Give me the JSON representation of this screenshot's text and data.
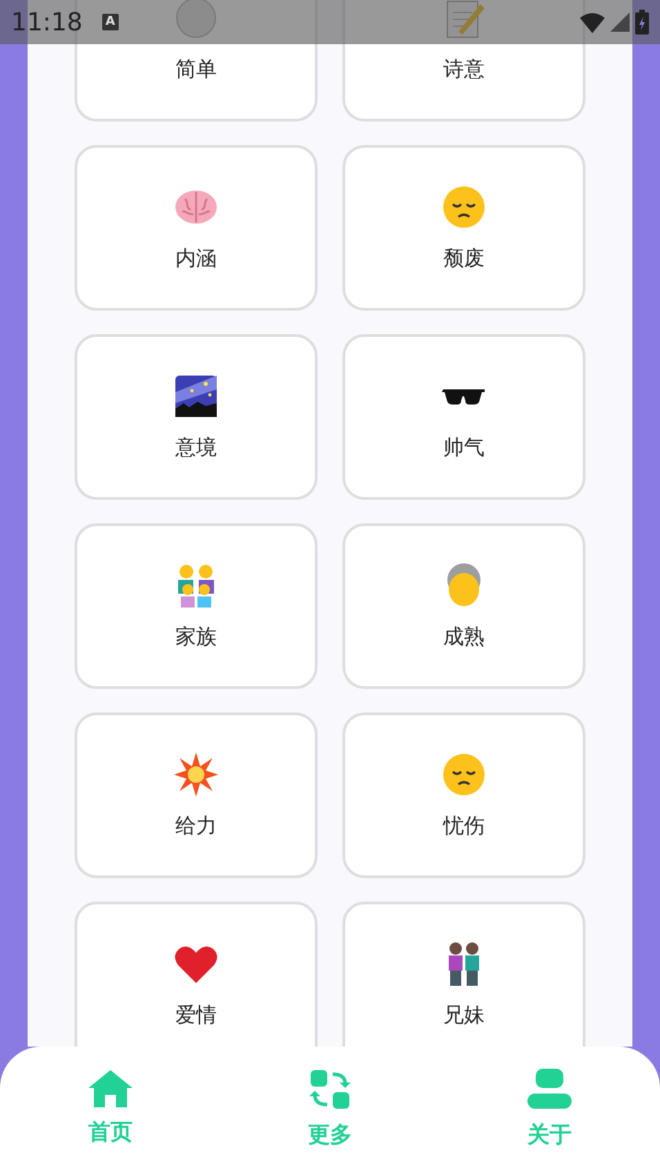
{
  "status_bar": {
    "time": "11:18",
    "notification": "A"
  },
  "cards": [
    {
      "label": "简单",
      "kind": "circle"
    },
    {
      "label": "诗意",
      "kind": "memo"
    },
    {
      "label": "内涵",
      "kind": "brain"
    },
    {
      "label": "颓废",
      "kind": "pensive"
    },
    {
      "label": "意境",
      "kind": "night"
    },
    {
      "label": "帅气",
      "kind": "sunglasses"
    },
    {
      "label": "家族",
      "kind": "family"
    },
    {
      "label": "成熟",
      "kind": "elder"
    },
    {
      "label": "给力",
      "kind": "burst"
    },
    {
      "label": "忧伤",
      "kind": "pensive"
    },
    {
      "label": "爱情",
      "kind": "heart"
    },
    {
      "label": "兄妹",
      "kind": "couple"
    }
  ],
  "nav": [
    {
      "label": "首页",
      "kind": "home"
    },
    {
      "label": "更多",
      "kind": "swap"
    },
    {
      "label": "关于",
      "kind": "user"
    }
  ]
}
